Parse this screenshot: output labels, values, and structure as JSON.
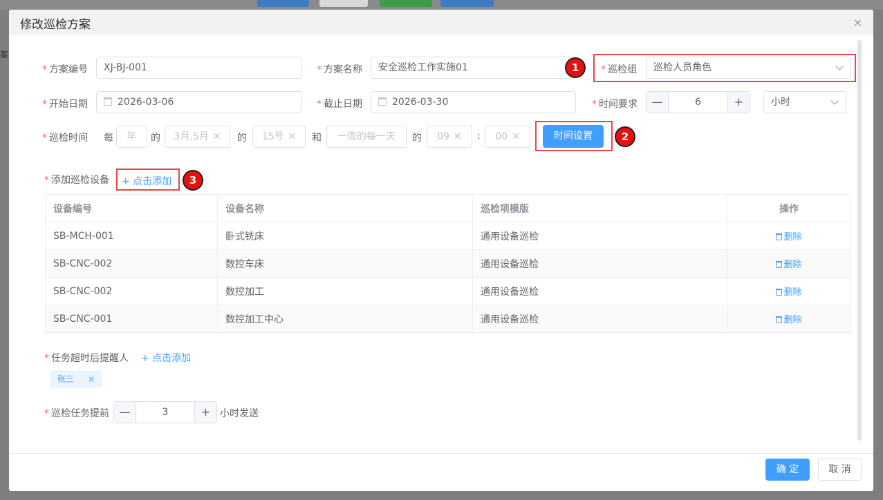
{
  "dialog": {
    "title": "修改巡检方案",
    "close_icon": "×"
  },
  "form": {
    "required_mark": "*",
    "plan_no": {
      "label": "方案编号",
      "value": "XJ-BJ-001"
    },
    "plan_name": {
      "label": "方案名称",
      "value": "安全巡检工作实施01"
    },
    "group": {
      "label": "巡检组",
      "value": "巡检人员角色"
    },
    "start_date": {
      "label": "开始日期",
      "value": "2026-03-06"
    },
    "end_date": {
      "label": "截止日期",
      "value": "2026-03-30"
    },
    "time_req": {
      "label": "时间要求",
      "value": "6",
      "unit": "小时"
    },
    "inspect_time": {
      "label": "巡检时间",
      "w_every": "每",
      "year_ph": "年",
      "w_de1": "的",
      "months": "3月,5月",
      "w_de2": "的",
      "day": "15号",
      "w_and": "和",
      "weekday_ph": "一周的每一天",
      "w_de3": "的",
      "hour": "09",
      "colon": ":",
      "minute": "00",
      "clear": "✕",
      "set_button": "时间设置"
    },
    "add_device": {
      "label": "添加巡检设备",
      "link": "+ 点击添加"
    },
    "reminder": {
      "label": "任务超时后提醒人",
      "link": "+ 点击添加",
      "tags": [
        "张三"
      ],
      "tag_close": "×"
    },
    "advance": {
      "label": "巡检任务提前",
      "value": "3",
      "suffix": "小时发送"
    },
    "stepper_minus": "—",
    "stepper_plus": "+"
  },
  "table": {
    "headers": [
      "设备编号",
      "设备名称",
      "巡检项模版",
      "操作"
    ],
    "rows": [
      {
        "code": "SB-MCH-001",
        "name": "卧式铣床",
        "template": "通用设备巡检",
        "action": "删除"
      },
      {
        "code": "SB-CNC-002",
        "name": "数控车床",
        "template": "通用设备巡检",
        "action": "删除"
      },
      {
        "code": "SB-CNC-002",
        "name": "数控加工",
        "template": "通用设备巡检",
        "action": "删除"
      },
      {
        "code": "SB-CNC-001",
        "name": "数控加工中心",
        "template": "通用设备巡检",
        "action": "删除"
      }
    ]
  },
  "footer": {
    "confirm": "确 定",
    "cancel": "取 消"
  },
  "annotations": [
    "1",
    "2",
    "3"
  ],
  "background": {
    "side_text": "案"
  },
  "colors": {
    "primary": "#409eff",
    "required": "#f56c6c",
    "highlight": "#e94545",
    "badge": "#e80f0f"
  }
}
